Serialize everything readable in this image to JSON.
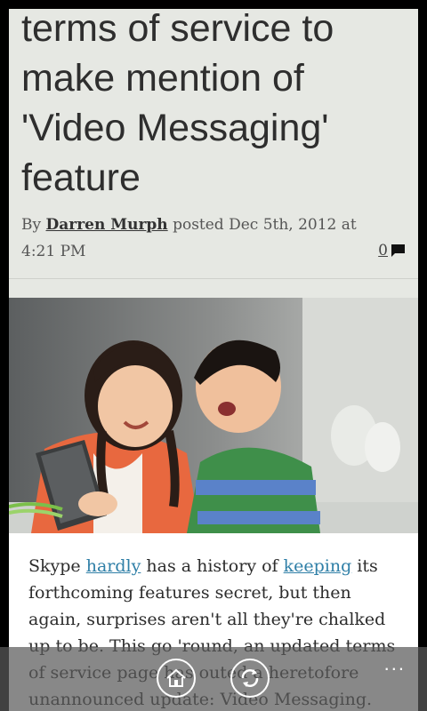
{
  "article": {
    "headline": "terms of service to make mention of 'Video Messaging' feature",
    "byline_prefix": "By ",
    "author": "Darren Murph",
    "posted_text": " posted Dec 5th, 2012 at 4:21 PM",
    "comment_count": "0",
    "body": {
      "t1": "Skype ",
      "link1": "hardly",
      "t2": " has a history of ",
      "link2": "keeping",
      "t3": " its forthcoming features secret, but then again, surprises aren't all they're chalked up to be. This go 'round, an updated terms of service page has outed a heretofore unannounced update: Video Messaging. While it's not"
    }
  },
  "appbar": {
    "icons": [
      "home-icon",
      "refresh-icon"
    ],
    "more": "..."
  },
  "colors": {
    "link": "#2f7fa7",
    "page_bg": "#e6e8e3",
    "appbar_bg": "#5a5a5a"
  }
}
